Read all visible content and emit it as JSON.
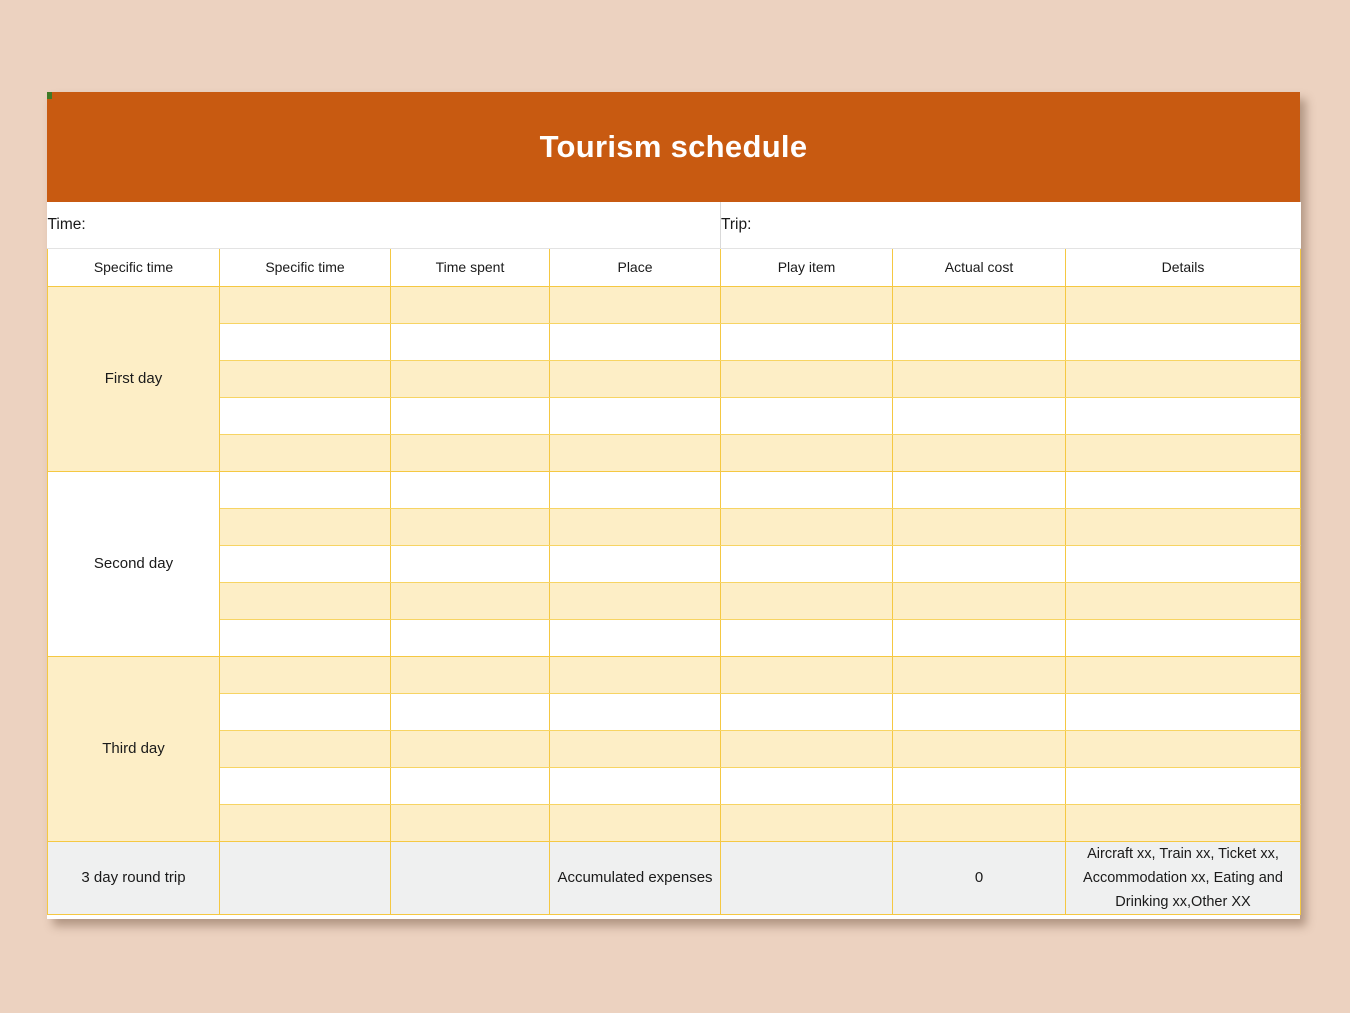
{
  "document": {
    "title": "Tourism schedule",
    "title_bar_color": "#c85a11",
    "page_background": "#ecd2c0",
    "grid_line_color": "#f5c842",
    "row_shade_color": "#fdeec6",
    "footer_shade_color": "#eff0f0"
  },
  "meta": {
    "time_label": "Time:",
    "time_value": "",
    "trip_label": "Trip:",
    "trip_value": ""
  },
  "table": {
    "columns": [
      "Specific time",
      "Specific time",
      "Time spent",
      "Place",
      "Play item",
      "Actual cost",
      "Details"
    ],
    "day_blocks": [
      {
        "label": "First day",
        "label_shade": "cream",
        "rows": [
          {
            "shade": "cream",
            "cells": [
              "",
              "",
              "",
              "",
              "",
              ""
            ]
          },
          {
            "shade": "white",
            "cells": [
              "",
              "",
              "",
              "",
              "",
              ""
            ]
          },
          {
            "shade": "cream",
            "cells": [
              "",
              "",
              "",
              "",
              "",
              ""
            ]
          },
          {
            "shade": "white",
            "cells": [
              "",
              "",
              "",
              "",
              "",
              ""
            ]
          },
          {
            "shade": "cream",
            "cells": [
              "",
              "",
              "",
              "",
              "",
              ""
            ]
          }
        ]
      },
      {
        "label": "Second day",
        "label_shade": "white",
        "rows": [
          {
            "shade": "white",
            "cells": [
              "",
              "",
              "",
              "",
              "",
              ""
            ]
          },
          {
            "shade": "cream",
            "cells": [
              "",
              "",
              "",
              "",
              "",
              ""
            ]
          },
          {
            "shade": "white",
            "cells": [
              "",
              "",
              "",
              "",
              "",
              ""
            ]
          },
          {
            "shade": "cream",
            "cells": [
              "",
              "",
              "",
              "",
              "",
              ""
            ]
          },
          {
            "shade": "white",
            "cells": [
              "",
              "",
              "",
              "",
              "",
              ""
            ]
          }
        ]
      },
      {
        "label": "Third day",
        "label_shade": "cream",
        "rows": [
          {
            "shade": "cream",
            "cells": [
              "",
              "",
              "",
              "",
              "",
              ""
            ]
          },
          {
            "shade": "white",
            "cells": [
              "",
              "",
              "",
              "",
              "",
              ""
            ]
          },
          {
            "shade": "cream",
            "cells": [
              "",
              "",
              "",
              "",
              "",
              ""
            ]
          },
          {
            "shade": "white",
            "cells": [
              "",
              "",
              "",
              "",
              "",
              ""
            ]
          },
          {
            "shade": "cream",
            "cells": [
              "",
              "",
              "",
              "",
              "",
              ""
            ]
          }
        ]
      }
    ],
    "footer": {
      "label": "3 day round trip",
      "c2": "",
      "c3": "",
      "place": "Accumulated expenses",
      "play_item": "",
      "actual_cost": "0",
      "details": "Aircraft xx, Train xx, Ticket xx, Accommodation xx, Eating and Drinking xx,Other XX"
    }
  }
}
